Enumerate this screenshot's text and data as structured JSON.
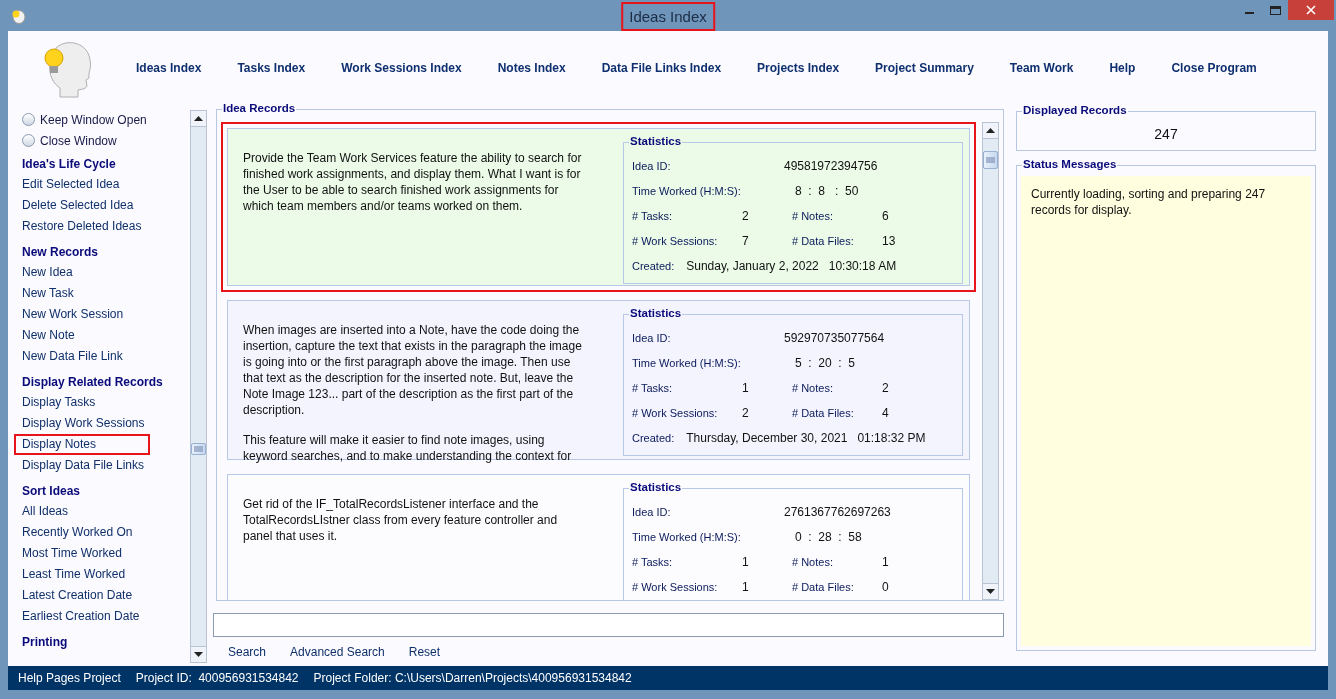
{
  "window": {
    "title": "Ideas Index",
    "title_highlighted": true
  },
  "nav": [
    "Ideas Index",
    "Tasks Index",
    "Work Sessions Index",
    "Notes Index",
    "Data File Links Index",
    "Projects Index",
    "Project Summary",
    "Team Work",
    "Help",
    "Close Program"
  ],
  "sidebar": {
    "options": [
      {
        "label": "Keep Window Open",
        "selected": false
      },
      {
        "label": "Close Window",
        "selected": false
      }
    ],
    "sections": [
      {
        "heading": "Idea's Life Cycle",
        "items": [
          {
            "label": "Edit Selected Idea",
            "highlighted": false
          },
          {
            "label": "Delete Selected Idea",
            "highlighted": false
          },
          {
            "label": "Restore Deleted Ideas",
            "highlighted": false
          }
        ]
      },
      {
        "heading": "New Records",
        "items": [
          {
            "label": "New Idea",
            "highlighted": false
          },
          {
            "label": "New Task",
            "highlighted": false
          },
          {
            "label": "New Work Session",
            "highlighted": false
          },
          {
            "label": "New Note",
            "highlighted": false
          },
          {
            "label": "New Data File Link",
            "highlighted": false
          }
        ]
      },
      {
        "heading": "Display Related Records",
        "items": [
          {
            "label": "Display Tasks",
            "highlighted": false
          },
          {
            "label": "Display Work Sessions",
            "highlighted": false
          },
          {
            "label": "Display Notes",
            "highlighted": true
          },
          {
            "label": "Display Data File Links",
            "highlighted": false
          }
        ]
      },
      {
        "heading": "Sort Ideas",
        "items": [
          {
            "label": "All Ideas",
            "highlighted": false
          },
          {
            "label": "Recently Worked On",
            "highlighted": false
          },
          {
            "label": "Most Time Worked",
            "highlighted": false
          },
          {
            "label": "Least Time Worked",
            "highlighted": false
          },
          {
            "label": "Latest Creation Date",
            "highlighted": false
          },
          {
            "label": "Earliest Creation Date",
            "highlighted": false
          }
        ]
      },
      {
        "heading": "Printing"
      }
    ]
  },
  "records": {
    "legend": "Idea Records",
    "items": [
      {
        "selected": true,
        "highlighted": true,
        "description": [
          "Provide the Team Work Services feature the ability to search for finished work assignments, and display them. What I want is for the User to be able to search finished work assignments for which team members and/or teams worked on them."
        ],
        "stats": {
          "legend": "Statistics",
          "id_label": "Idea ID:",
          "id": "49581972394756",
          "time_label": "Time Worked (H:M:S):",
          "time": "8  :  8   :  50",
          "tasks_label": "# Tasks:",
          "tasks": "2",
          "notes_label": "# Notes:",
          "notes": "6",
          "sessions_label": "# Work Sessions:",
          "sessions": "7",
          "files_label": "# Data Files:",
          "files": "13",
          "created_label": "Created:",
          "created": "Sunday, January 2, 2022   10:30:18 AM"
        }
      },
      {
        "selected": false,
        "highlighted": false,
        "description": [
          "When images are inserted into a Note, have the code doing the insertion, capture the text that exists in the paragraph the image is going into or the first paragraph above the image. Then use that text as the description for the inserted note. But, leave the Note Image 123... part of the description as the first part of the description.",
          "This feature will make it easier to find note images, using keyword searches, and to make understanding the context for"
        ],
        "stats": {
          "legend": "Statistics",
          "id_label": "Idea ID:",
          "id": "592970735077564",
          "time_label": "Time Worked (H:M:S):",
          "time": "5  :  20  :  5",
          "tasks_label": "# Tasks:",
          "tasks": "1",
          "notes_label": "# Notes:",
          "notes": "2",
          "sessions_label": "# Work Sessions:",
          "sessions": "2",
          "files_label": "# Data Files:",
          "files": "4",
          "created_label": "Created:",
          "created": "Thursday, December 30, 2021   01:18:32 PM"
        }
      },
      {
        "selected": false,
        "highlighted": false,
        "description": [
          "Get rid of the IF_TotalRecordsListener interface and the TotalRecordsLIstner class from every feature controller and panel that uses it."
        ],
        "stats": {
          "legend": "Statistics",
          "id_label": "Idea ID:",
          "id": "2761367762697263",
          "time_label": "Time Worked (H:M:S):",
          "time": "0  :  28  :  58",
          "tasks_label": "# Tasks:",
          "tasks": "1",
          "notes_label": "# Notes:",
          "notes": "1",
          "sessions_label": "# Work Sessions:",
          "sessions": "1",
          "files_label": "# Data Files:",
          "files": "0"
        }
      }
    ]
  },
  "search_buttons": [
    "Search",
    "Advanced Search",
    "Reset"
  ],
  "displayed": {
    "legend": "Displayed Records",
    "count": "247"
  },
  "status_messages": {
    "legend": "Status Messages",
    "message": "Currently loading, sorting and preparing 247 records for display."
  },
  "status_bar": [
    "Help Pages Project",
    "Project ID:  400956931534842",
    "Project Folder: C:\\Users\\Darren\\Projects\\400956931534842"
  ]
}
